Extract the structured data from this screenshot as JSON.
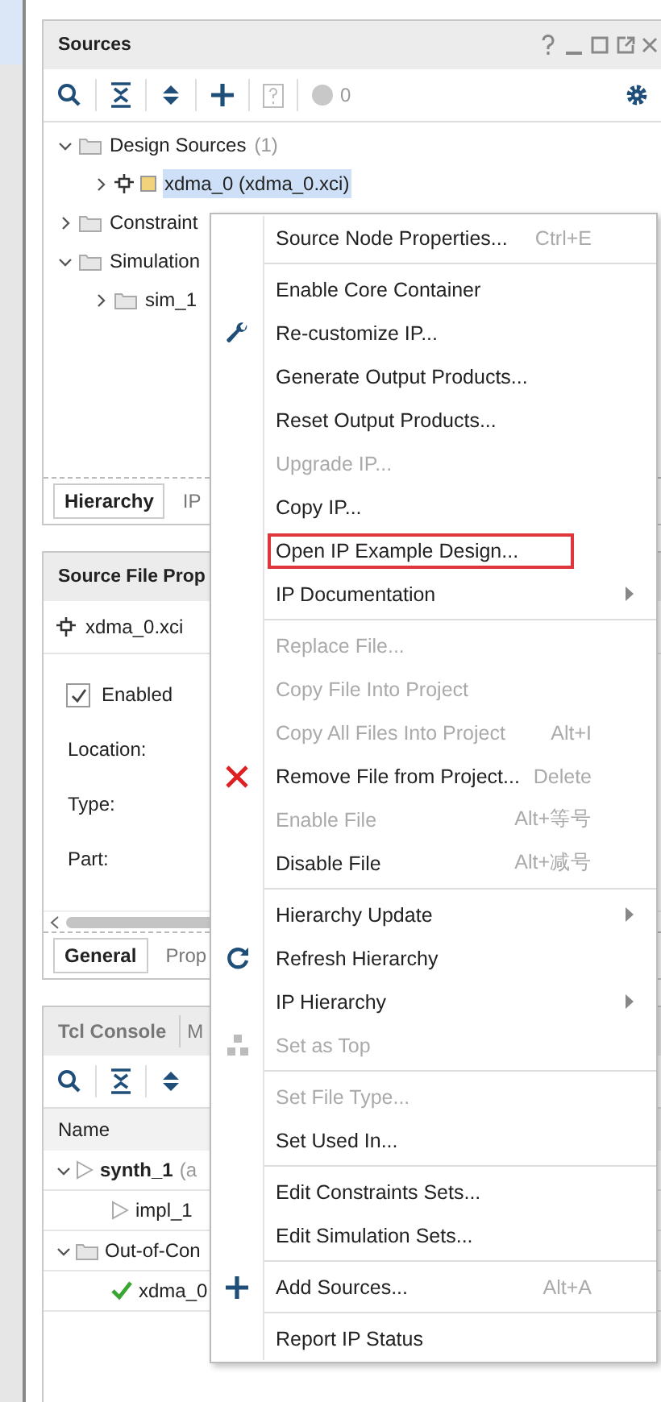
{
  "sources": {
    "title": "Sources",
    "badge_count": "0",
    "tree": [
      {
        "label": "Design Sources",
        "count": "(1)",
        "expanded": true,
        "selected": false,
        "folder": true,
        "children": [
          {
            "label": "xdma_0 (xdma_0.xci)",
            "expanded": false,
            "selected": true,
            "folder": false
          }
        ]
      },
      {
        "label": "Constraint",
        "expanded": false,
        "selected": false,
        "folder": true
      },
      {
        "label": "Simulation",
        "expanded": true,
        "selected": false,
        "folder": true,
        "children": [
          {
            "label": "sim_1",
            "expanded": false,
            "selected": false,
            "folder": true
          }
        ]
      }
    ],
    "tabs": [
      {
        "label": "Hierarchy",
        "selected": true
      },
      {
        "label": "IP",
        "selected": false
      }
    ]
  },
  "properties": {
    "title": "Source File Prop",
    "file": "xdma_0.xci",
    "enabled": {
      "label": "Enabled",
      "checked": true
    },
    "fields": [
      "Location:",
      "Type:",
      "Part:"
    ],
    "tabs": [
      {
        "label": "General",
        "selected": true
      },
      {
        "label": "Prop",
        "selected": false
      }
    ]
  },
  "console": {
    "tabs": [
      {
        "label": "Tcl Console",
        "selected": true
      },
      {
        "label": "M",
        "selected": false
      }
    ],
    "column": "Name",
    "rows": [
      {
        "kind": "run",
        "label": "synth_1",
        "note": "(a",
        "expanded": true,
        "children": [
          {
            "kind": "run",
            "label": "impl_1"
          }
        ]
      },
      {
        "kind": "folder",
        "label": "Out-of-Con",
        "expanded": true,
        "children": [
          {
            "kind": "done",
            "label": "xdma_0"
          }
        ]
      }
    ]
  },
  "menu": [
    {
      "kind": "plain",
      "label": "Source Node Properties...",
      "shortcut": "Ctrl+E",
      "disabled": false
    },
    {
      "kind": "separator"
    },
    {
      "kind": "plain",
      "label": "Enable Core Container",
      "disabled": false
    },
    {
      "kind": "wrench",
      "label": "Re-customize IP...",
      "disabled": false
    },
    {
      "kind": "plain",
      "label": "Generate Output Products...",
      "disabled": false
    },
    {
      "kind": "plain",
      "label": "Reset Output Products...",
      "disabled": false
    },
    {
      "kind": "plain",
      "label": "Upgrade IP...",
      "disabled": true
    },
    {
      "kind": "plain",
      "label": "Copy IP...",
      "disabled": false
    },
    {
      "kind": "plain",
      "label": "Open IP Example Design...",
      "disabled": false,
      "highlighted": true
    },
    {
      "kind": "plain",
      "label": "IP Documentation",
      "disabled": false,
      "submenu": true
    },
    {
      "kind": "separator"
    },
    {
      "kind": "plain",
      "label": "Replace File...",
      "disabled": true
    },
    {
      "kind": "plain",
      "label": "Copy File Into Project",
      "disabled": true
    },
    {
      "kind": "plain",
      "label": "Copy All Files Into Project",
      "shortcut": "Alt+I",
      "disabled": true
    },
    {
      "kind": "remove",
      "label": "Remove File from Project...",
      "shortcut": "Delete",
      "disabled": false
    },
    {
      "kind": "plain",
      "label": "Enable File",
      "shortcut": "Alt+等号",
      "disabled": true
    },
    {
      "kind": "plain",
      "label": "Disable File",
      "shortcut": "Alt+减号",
      "disabled": false
    },
    {
      "kind": "separator"
    },
    {
      "kind": "plain",
      "label": "Hierarchy Update",
      "disabled": false,
      "submenu": true
    },
    {
      "kind": "refresh",
      "label": "Refresh Hierarchy",
      "disabled": false
    },
    {
      "kind": "plain",
      "label": "IP Hierarchy",
      "disabled": false,
      "submenu": true
    },
    {
      "kind": "settop",
      "label": "Set as Top",
      "disabled": true
    },
    {
      "kind": "separator"
    },
    {
      "kind": "plain",
      "label": "Set File Type...",
      "disabled": true
    },
    {
      "kind": "plain",
      "label": "Set Used In...",
      "disabled": false
    },
    {
      "kind": "separator"
    },
    {
      "kind": "plain",
      "label": "Edit Constraints Sets...",
      "disabled": false
    },
    {
      "kind": "plain",
      "label": "Edit Simulation Sets...",
      "disabled": false
    },
    {
      "kind": "separator"
    },
    {
      "kind": "add",
      "label": "Add Sources...",
      "shortcut": "Alt+A",
      "disabled": false
    },
    {
      "kind": "separator"
    },
    {
      "kind": "plain",
      "label": "Report IP Status",
      "disabled": false
    }
  ]
}
